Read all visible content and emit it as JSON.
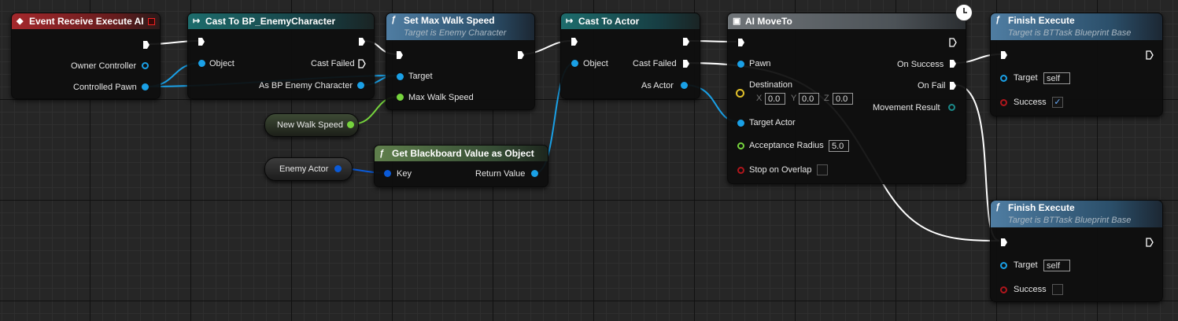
{
  "nodes": {
    "event": {
      "title": "Event Receive Execute AI",
      "pins": {
        "owner_controller": "Owner Controller",
        "controlled_pawn": "Controlled Pawn"
      }
    },
    "cast_enemy": {
      "title": "Cast To BP_EnemyCharacter",
      "pins": {
        "object": "Object",
        "cast_failed": "Cast Failed",
        "as_bp_enemy": "As BP Enemy Character"
      }
    },
    "set_speed": {
      "title": "Set Max Walk Speed",
      "subtitle": "Target is Enemy Character",
      "pins": {
        "target": "Target",
        "max_walk_speed": "Max Walk Speed"
      }
    },
    "cast_actor": {
      "title": "Cast To Actor",
      "pins": {
        "object": "Object",
        "cast_failed": "Cast Failed",
        "as_actor": "As Actor"
      }
    },
    "ai_moveto": {
      "title": "AI MoveTo",
      "pins": {
        "pawn": "Pawn",
        "destination": "Destination",
        "target_actor": "Target Actor",
        "acceptance_radius": "Acceptance Radius",
        "stop_on_overlap": "Stop on Overlap",
        "on_success": "On Success",
        "on_fail": "On Fail",
        "movement_result": "Movement Result"
      },
      "destination": {
        "x_label": "X",
        "x": "0.0",
        "y_label": "Y",
        "y": "0.0",
        "z_label": "Z",
        "z": "0.0"
      },
      "acceptance_radius_value": "5.0",
      "stop_on_overlap_checked": false
    },
    "get_bb": {
      "title": "Get Blackboard Value as Object",
      "pins": {
        "key": "Key",
        "return_value": "Return Value"
      }
    },
    "finish_1": {
      "title": "Finish Execute",
      "subtitle": "Target is BTTask Blueprint Base",
      "pins": {
        "target": "Target",
        "success": "Success"
      },
      "target_value": "self",
      "success_checked": true,
      "success_mark": "✓"
    },
    "finish_2": {
      "title": "Finish Execute",
      "subtitle": "Target is BTTask Blueprint Base",
      "pins": {
        "target": "Target",
        "success": "Success"
      },
      "target_value": "self",
      "success_checked": false
    }
  },
  "variables": {
    "new_walk_speed": "New Walk Speed",
    "enemy_actor": "Enemy Actor"
  },
  "icons": {
    "event": "event-diamond-icon",
    "cast": "cast-arrows-icon",
    "function": "function-f-icon",
    "ai_moveto": "ai-moveto-icon",
    "latent": "clock-icon"
  },
  "colors": {
    "exec": "#ffffff",
    "object_pin": "#1aa0e6",
    "float_pin": "#76d43d",
    "vector_pin": "#e1c02a",
    "bool_pin": "#b0161c",
    "enum_pin": "#1b8a8a",
    "name_pin": "#0a5ad8",
    "event_header": "#a4282c",
    "cast_header": "#1d6c6c",
    "function_header": "#4f7da2",
    "pure_header": "#5f7f4c"
  }
}
